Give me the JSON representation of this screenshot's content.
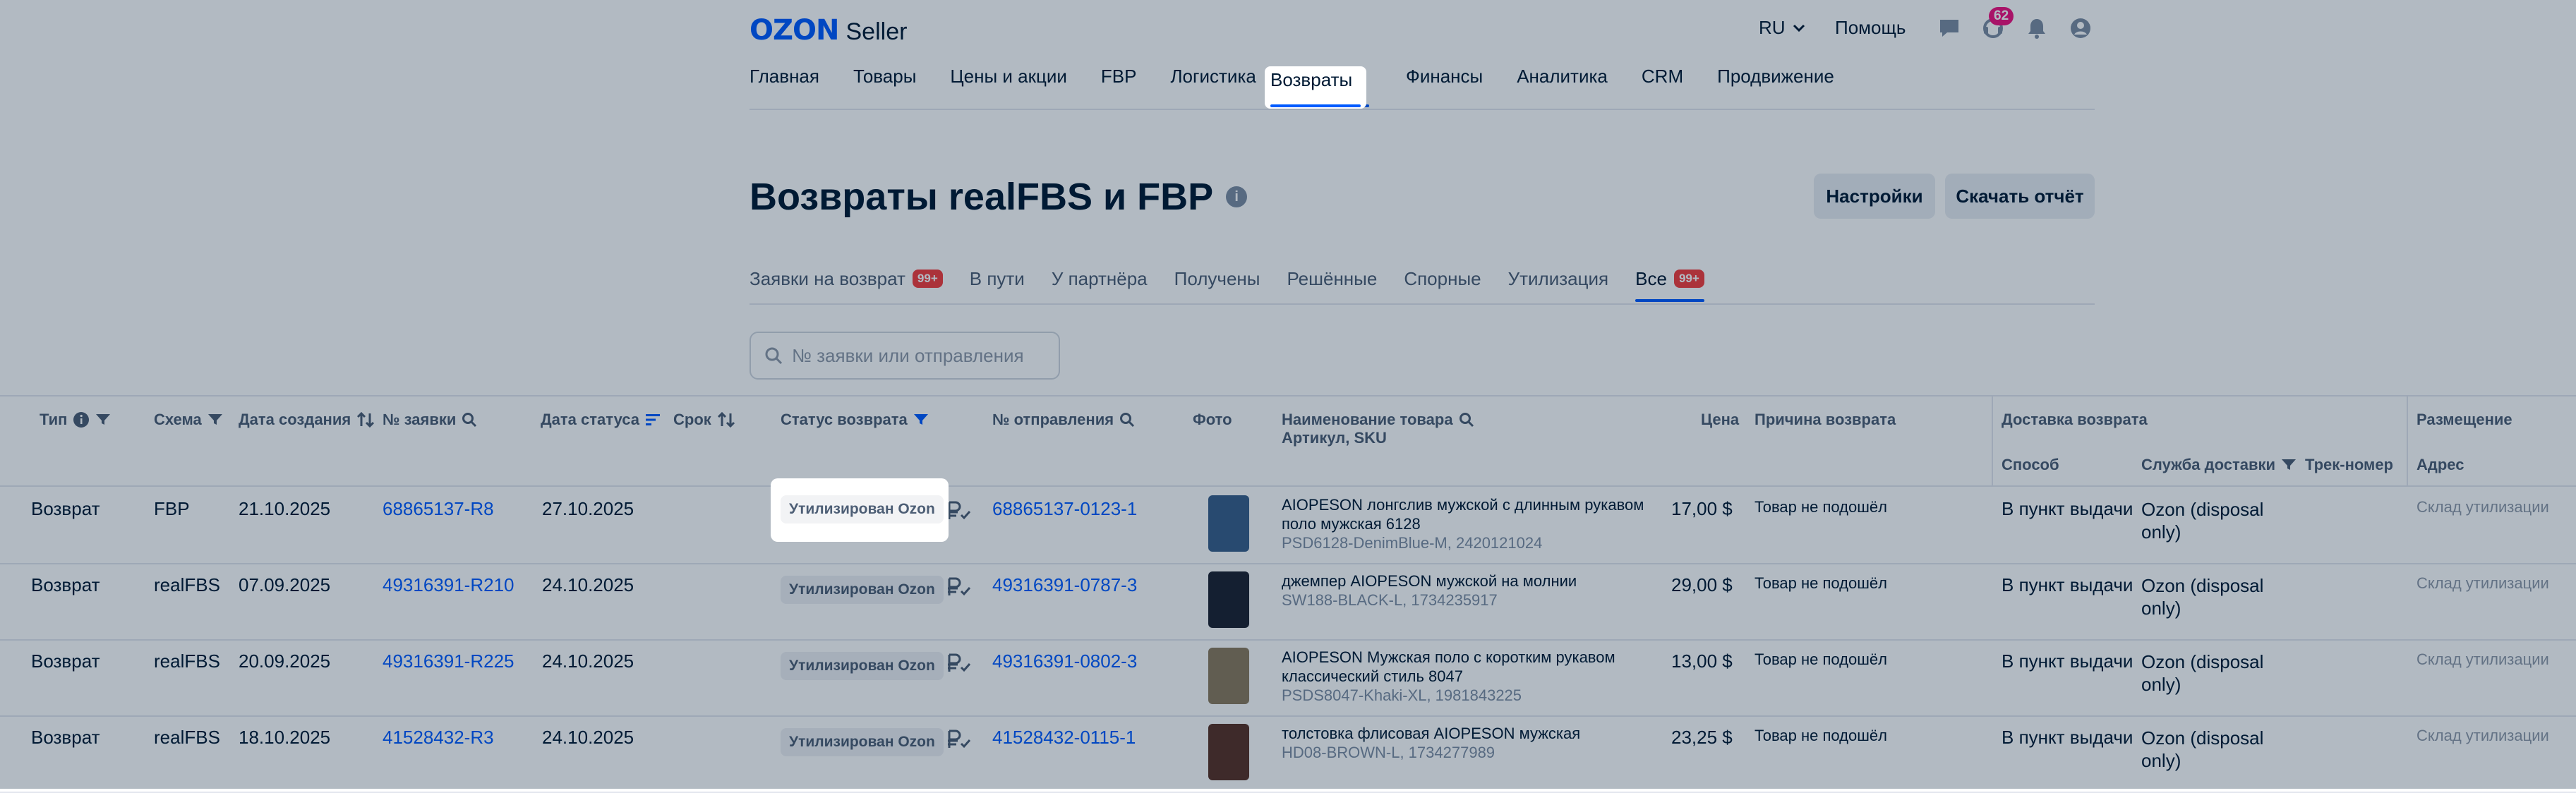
{
  "header": {
    "logo_main": "OZON",
    "logo_sub": "Seller",
    "language": "RU",
    "help": "Помощь",
    "notification_count": "62",
    "icons": [
      "chat-icon",
      "support-icon",
      "bell-icon",
      "profile-icon"
    ]
  },
  "topnav": [
    {
      "label": "Главная"
    },
    {
      "label": "Товары"
    },
    {
      "label": "Цены и акции"
    },
    {
      "label": "FBP"
    },
    {
      "label": "Логистика"
    },
    {
      "label": "Возвраты",
      "active": true
    },
    {
      "label": "Финансы"
    },
    {
      "label": "Аналитика"
    },
    {
      "label": "CRM"
    },
    {
      "label": "Продвижение"
    }
  ],
  "page": {
    "title": "Возвраты realFBS и FBP",
    "settings_button": "Настройки",
    "report_button": "Скачать отчёт"
  },
  "subtabs": [
    {
      "label": "Заявки на возврат",
      "count": "99+"
    },
    {
      "label": "В пути"
    },
    {
      "label": "У партнёра"
    },
    {
      "label": "Получены"
    },
    {
      "label": "Решённые"
    },
    {
      "label": "Спорные"
    },
    {
      "label": "Утилизация"
    },
    {
      "label": "Все",
      "count": "99+",
      "active": true
    }
  ],
  "search": {
    "placeholder": "№ заявки или отправления"
  },
  "table": {
    "headers": {
      "type": "Тип",
      "scheme": "Схема",
      "created": "Дата создания",
      "request_no": "№ заявки",
      "status_date": "Дата статуса",
      "term": "Срок",
      "status": "Статус возврата",
      "shipment_no": "№ отправления",
      "photo": "Фото",
      "product_name": "Наименование товара",
      "article": "Артикул, SKU",
      "price": "Цена",
      "reason": "Причина возврата",
      "delivery_group": "Доставка возврата",
      "method": "Способ",
      "service": "Служба доставки",
      "track": "Трек-номер",
      "placement_group": "Размещение",
      "address": "Адрес"
    },
    "rows": [
      {
        "type": "Возврат",
        "scheme": "FBP",
        "created": "21.10.2025",
        "request_no": "68865137-R8",
        "status_date": "27.10.2025",
        "status": "Утилизирован Ozon",
        "shipment_no": "68865137-0123-1",
        "name_line1": "AIOPESON лонгслив мужской с длинным рукавом",
        "name_line2": "поло мужская 6128",
        "sku": "PSD6128-DenimBlue-M, 2420121024",
        "price": "17,00 $",
        "reason": "Товар не подошёл",
        "method": "В пункт выдачи",
        "service_line1": "Ozon (disposal",
        "service_line2": "only)",
        "address": "Склад утилизации",
        "photo_color": "#3a5f8a"
      },
      {
        "type": "Возврат",
        "scheme": "realFBS",
        "created": "07.09.2025",
        "request_no": "49316391-R210",
        "status_date": "24.10.2025",
        "status": "Утилизирован Ozon",
        "shipment_no": "49316391-0787-3",
        "name_line1": "джемпер AIOPESON мужской на молнии",
        "name_line2": "",
        "sku": "SW188-BLACK-L, 1734235917",
        "price": "29,00 $",
        "reason": "Товар не подошёл",
        "method": "В пункт выдачи",
        "service_line1": "Ozon (disposal",
        "service_line2": "only)",
        "address": "Склад утилизации",
        "photo_color": "#1d2230"
      },
      {
        "type": "Возврат",
        "scheme": "realFBS",
        "created": "20.09.2025",
        "request_no": "49316391-R225",
        "status_date": "24.10.2025",
        "status": "Утилизирован Ozon",
        "shipment_no": "49316391-0802-3",
        "name_line1": "AIOPESON Мужская поло с коротким рукавом",
        "name_line2": "классический стиль 8047",
        "sku": "PSDS8047-Khaki-XL, 1981843225",
        "price": "13,00 $",
        "reason": "Товар не подошёл",
        "method": "В пункт выдачи",
        "service_line1": "Ozon (disposal",
        "service_line2": "only)",
        "address": "Склад утилизации",
        "photo_color": "#8b7a5e"
      },
      {
        "type": "Возврат",
        "scheme": "realFBS",
        "created": "18.10.2025",
        "request_no": "41528432-R3",
        "status_date": "24.10.2025",
        "status": "Утилизирован Ozon",
        "shipment_no": "41528432-0115-1",
        "name_line1": "толстовка флисовая AIOPESON мужская",
        "name_line2": "",
        "sku": "HD08-BROWN-L, 1734277989",
        "price": "23,25 $",
        "reason": "Товар не подошёл",
        "method": "В пункт выдачи",
        "service_line1": "Ozon (disposal",
        "service_line2": "only)",
        "address": "Склад утилизации",
        "photo_color": "#5a3226"
      }
    ]
  },
  "colors": {
    "accent": "#005bff",
    "badge": "#f53d3d",
    "notification": "#f1117e",
    "overlay": "rgba(0,26,52,0.30)"
  }
}
